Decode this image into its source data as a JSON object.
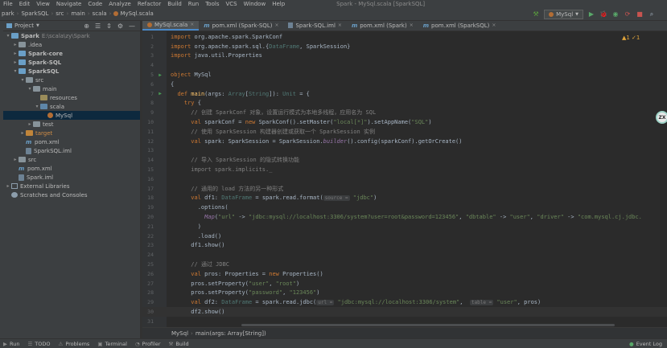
{
  "menubar": {
    "items": [
      "File",
      "Edit",
      "View",
      "Navigate",
      "Code",
      "Analyze",
      "Refactor",
      "Build",
      "Run",
      "Tools",
      "VCS",
      "Window",
      "Help"
    ],
    "window_title": "Spark - MySql.scala [SparkSQL]"
  },
  "navbar": {
    "crumbs": [
      "park",
      "SparkSQL",
      "src",
      "main",
      "scala",
      "MySql.scala"
    ],
    "run_config": "MySql"
  },
  "project": {
    "title": "Project",
    "tree": [
      {
        "depth": 0,
        "arrow": "v",
        "icon": "folder-blue",
        "label": "Spark",
        "extra": "E:\\scala\\zy\\Spark",
        "bold": true
      },
      {
        "depth": 1,
        "arrow": ">",
        "icon": "folder",
        "label": ".idea"
      },
      {
        "depth": 1,
        "arrow": ">",
        "icon": "folder-blue",
        "label": "Spark-core",
        "bold": true
      },
      {
        "depth": 1,
        "arrow": ">",
        "icon": "folder-blue",
        "label": "Spark-SQL",
        "bold": true
      },
      {
        "depth": 1,
        "arrow": "v",
        "icon": "folder-blue",
        "label": "SparkSQL",
        "bold": true
      },
      {
        "depth": 2,
        "arrow": "v",
        "icon": "folder",
        "label": "src"
      },
      {
        "depth": 3,
        "arrow": "v",
        "icon": "folder",
        "label": "main"
      },
      {
        "depth": 4,
        "arrow": "",
        "icon": "folder-res",
        "label": "resources"
      },
      {
        "depth": 4,
        "arrow": "v",
        "icon": "folder-src",
        "label": "scala"
      },
      {
        "depth": 5,
        "arrow": "",
        "icon": "scala-object",
        "label": "MySql",
        "selected": true
      },
      {
        "depth": 3,
        "arrow": ">",
        "icon": "folder",
        "label": "test"
      },
      {
        "depth": 2,
        "arrow": ">",
        "icon": "folder-orange",
        "label": "target",
        "orange": true
      },
      {
        "depth": 2,
        "arrow": "",
        "icon": "maven",
        "label": "pom.xml"
      },
      {
        "depth": 2,
        "arrow": "",
        "icon": "iml",
        "label": "SparkSQL.iml"
      },
      {
        "depth": 1,
        "arrow": ">",
        "icon": "folder",
        "label": "src"
      },
      {
        "depth": 1,
        "arrow": "",
        "icon": "maven",
        "label": "pom.xml"
      },
      {
        "depth": 1,
        "arrow": "",
        "icon": "iml",
        "label": "Spark.iml"
      },
      {
        "depth": 0,
        "arrow": ">",
        "icon": "libraries",
        "label": "External Libraries"
      },
      {
        "depth": 0,
        "arrow": "",
        "icon": "scratches",
        "label": "Scratches and Consoles"
      }
    ]
  },
  "tabs": [
    {
      "label": "MySql.scala",
      "icon": "scala",
      "active": true
    },
    {
      "label": "pom.xml (Spark-SQL)",
      "icon": "maven"
    },
    {
      "label": "Spark-SQL.iml",
      "icon": "iml"
    },
    {
      "label": "pom.xml (Spark)",
      "icon": "maven"
    },
    {
      "label": "pom.xml (SparkSQL)",
      "icon": "maven"
    }
  ],
  "editor": {
    "inspections": "▲1 ✓1",
    "lines": [
      {
        "n": "1",
        "tokens": [
          [
            "k",
            "import "
          ],
          [
            "m",
            "org.apache.spark.SparkConf"
          ]
        ]
      },
      {
        "n": "2",
        "tokens": [
          [
            "k",
            "import "
          ],
          [
            "m",
            "org.apache.spark.sql.{"
          ],
          [
            "t",
            "DataFrame"
          ],
          [
            "m",
            ", SparkSession}"
          ]
        ]
      },
      {
        "n": "3",
        "tokens": [
          [
            "k",
            "import "
          ],
          [
            "m",
            "java.util.Properties"
          ]
        ]
      },
      {
        "n": "4",
        "tokens": []
      },
      {
        "n": "5",
        "mark": "▶",
        "tokens": [
          [
            "k",
            "object "
          ],
          [
            "m",
            "MySql"
          ]
        ]
      },
      {
        "n": "6",
        "tokens": [
          [
            "m",
            "{"
          ]
        ]
      },
      {
        "n": "7",
        "mark": "▶",
        "tokens": [
          [
            "m",
            "  "
          ],
          [
            "k",
            "def "
          ],
          [
            "f",
            "main"
          ],
          [
            "m",
            "(args: "
          ],
          [
            "t",
            "Array"
          ],
          [
            "m",
            "["
          ],
          [
            "t",
            "String"
          ],
          [
            "m",
            "]): "
          ],
          [
            "t",
            "Unit"
          ],
          [
            "m",
            " = {"
          ]
        ]
      },
      {
        "n": "8",
        "tokens": [
          [
            "m",
            "    "
          ],
          [
            "k",
            "try "
          ],
          [
            "m",
            "{"
          ]
        ]
      },
      {
        "n": "9",
        "tokens": [
          [
            "m",
            "      "
          ],
          [
            "c",
            "// 创建 SparkConf 对象，设置运行模式为本地多线程，应用名为 SQL"
          ]
        ]
      },
      {
        "n": "10",
        "tokens": [
          [
            "m",
            "      "
          ],
          [
            "k",
            "val "
          ],
          [
            "m",
            "sparkConf = "
          ],
          [
            "k",
            "new "
          ],
          [
            "m",
            "SparkConf().setMaster("
          ],
          [
            "s",
            "\"local[*]\""
          ],
          [
            "m",
            ").setAppName("
          ],
          [
            "s",
            "\"SQL\""
          ],
          [
            "m",
            ")"
          ]
        ]
      },
      {
        "n": "11",
        "tokens": [
          [
            "m",
            "      "
          ],
          [
            "c",
            "// 使用 SparkSession 构建器创建或获取一个 SparkSession 实例"
          ]
        ]
      },
      {
        "n": "12",
        "tokens": [
          [
            "m",
            "      "
          ],
          [
            "k",
            "val "
          ],
          [
            "m",
            "spark: SparkSession = SparkSession."
          ],
          [
            "i",
            "builder"
          ],
          [
            "m",
            "().config(sparkConf).getOrCreate()"
          ]
        ]
      },
      {
        "n": "13",
        "tokens": []
      },
      {
        "n": "14",
        "tokens": [
          [
            "m",
            "      "
          ],
          [
            "c",
            "// 导入 SparkSession 的隐式转换功能"
          ]
        ]
      },
      {
        "n": "15",
        "tokens": [
          [
            "m",
            "      "
          ],
          [
            "c",
            "import spark.implicits._"
          ]
        ]
      },
      {
        "n": "16",
        "tokens": []
      },
      {
        "n": "17",
        "tokens": [
          [
            "m",
            "      "
          ],
          [
            "c",
            "// 通用的 load 方法的另一种形式"
          ]
        ]
      },
      {
        "n": "18",
        "tokens": [
          [
            "m",
            "      "
          ],
          [
            "k",
            "val "
          ],
          [
            "m",
            "df1: "
          ],
          [
            "t",
            "DataFrame"
          ],
          [
            "m",
            " = spark.read.format("
          ],
          [
            "h",
            "source ="
          ],
          [
            "s",
            " \"jdbc\""
          ],
          [
            "m",
            ")"
          ]
        ]
      },
      {
        "n": "19",
        "tokens": [
          [
            "m",
            "        .options("
          ]
        ]
      },
      {
        "n": "20",
        "tokens": [
          [
            "m",
            "          "
          ],
          [
            "i",
            "Map"
          ],
          [
            "m",
            "("
          ],
          [
            "s",
            "\"url\""
          ],
          [
            "m",
            " -> "
          ],
          [
            "s",
            "\"jdbc:mysql://localhost:3306/system?user=root&password=123456\""
          ],
          [
            "m",
            ", "
          ],
          [
            "s",
            "\"dbtable\""
          ],
          [
            "m",
            " -> "
          ],
          [
            "s",
            "\"user\""
          ],
          [
            "m",
            ", "
          ],
          [
            "s",
            "\"driver\""
          ],
          [
            "m",
            " -> "
          ],
          [
            "s",
            "\"com.mysql.cj.jdbc."
          ]
        ]
      },
      {
        "n": "21",
        "tokens": [
          [
            "m",
            "        )"
          ]
        ]
      },
      {
        "n": "22",
        "tokens": [
          [
            "m",
            "        .load()"
          ]
        ]
      },
      {
        "n": "23",
        "tokens": [
          [
            "m",
            "      df1.show()"
          ]
        ]
      },
      {
        "n": "24",
        "tokens": []
      },
      {
        "n": "25",
        "tokens": [
          [
            "m",
            "      "
          ],
          [
            "c",
            "// 通过 JDBC"
          ]
        ]
      },
      {
        "n": "26",
        "tokens": [
          [
            "m",
            "      "
          ],
          [
            "k",
            "val "
          ],
          [
            "m",
            "pros: Properties = "
          ],
          [
            "k",
            "new "
          ],
          [
            "m",
            "Properties()"
          ]
        ]
      },
      {
        "n": "27",
        "tokens": [
          [
            "m",
            "      pros.setProperty("
          ],
          [
            "s",
            "\"user\""
          ],
          [
            "m",
            ", "
          ],
          [
            "s",
            "\"root\""
          ],
          [
            "m",
            ")"
          ]
        ]
      },
      {
        "n": "28",
        "tokens": [
          [
            "m",
            "      pros.setProperty("
          ],
          [
            "s",
            "\"password\""
          ],
          [
            "m",
            ", "
          ],
          [
            "s",
            "\"123456\""
          ],
          [
            "m",
            ")"
          ]
        ]
      },
      {
        "n": "29",
        "tokens": [
          [
            "m",
            "      "
          ],
          [
            "k",
            "val "
          ],
          [
            "m",
            "df2: "
          ],
          [
            "t",
            "DataFrame"
          ],
          [
            "m",
            " = spark.read.jdbc("
          ],
          [
            "h",
            "url ="
          ],
          [
            "s",
            " \"jdbc:mysql://localhost:3306/system\""
          ],
          [
            "m",
            ",  "
          ],
          [
            "h",
            "table ="
          ],
          [
            "s",
            " \"user\""
          ],
          [
            "m",
            ", pros)"
          ]
        ]
      },
      {
        "n": "30",
        "current": true,
        "tokens": [
          [
            "m",
            "      df2.show()"
          ]
        ]
      },
      {
        "n": "31",
        "tokens": []
      },
      {
        "n": "32",
        "tokens": [
          [
            "m",
            "      "
          ],
          [
            "c",
            "// 通过 SparkSession 写出数据"
          ]
        ]
      }
    ]
  },
  "editor_breadcrumb": [
    "MySql",
    "main(args: Array[String])"
  ],
  "statusbar": {
    "items": [
      "Run",
      "TODO",
      "Problems",
      "Terminal",
      "Profiler",
      "Build"
    ],
    "right": "Event Log"
  },
  "plugin_badge": "ZX"
}
